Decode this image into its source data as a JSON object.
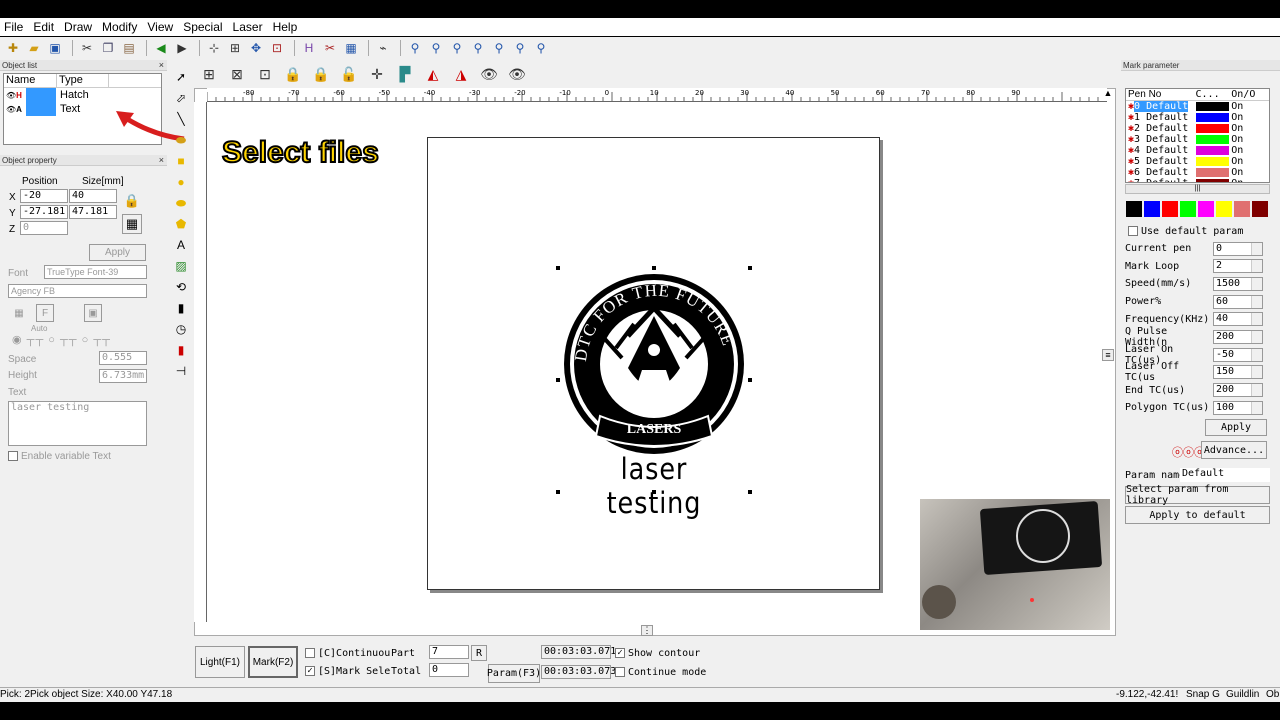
{
  "menu": [
    "File",
    "Edit",
    "Draw",
    "Modify",
    "View",
    "Special",
    "Laser",
    "Help"
  ],
  "object_list": {
    "title": "Object list",
    "col_name": "Name",
    "col_type": "Type",
    "rows": [
      {
        "type": "Hatch"
      },
      {
        "type": "Text"
      }
    ]
  },
  "object_property": {
    "title": "Object property",
    "position_label": "Position",
    "size_label": "Size[mm]",
    "x_label": "X",
    "y_label": "Y",
    "z_label": "Z",
    "x_pos": "-20",
    "y_pos": "-27.181",
    "z_pos": "0",
    "x_size": "40",
    "y_size": "47.181",
    "apply": "Apply",
    "font_label": "Font",
    "font_type": "TrueType Font-39",
    "font_name": "Agency FB",
    "auto": "Auto",
    "space_label": "Space",
    "space_value": "0.555",
    "height_label": "Height",
    "height_value": "6.733mm",
    "text_label": "Text",
    "text_value": "laser testing",
    "variable_text": "Enable variable Text"
  },
  "caption": "Select files",
  "canvas": {
    "logo_top": "DTC FOR THE FUTURE",
    "logo_bottom": "LASERS",
    "text": "laser testing",
    "ruler_labels": [
      "-80",
      "-70",
      "-60",
      "-50",
      "-40",
      "-30",
      "-20",
      "-10",
      "0",
      "10",
      "20",
      "30",
      "40",
      "50",
      "60",
      "70",
      "80",
      "90"
    ]
  },
  "bottom": {
    "light": "Light(F1)",
    "mark": "Mark(F2)",
    "continuous": "[C]Continuou",
    "mark_sele": "[S]Mark Sele",
    "part_label": "Part",
    "part_value": "7",
    "r": "R",
    "total_label": "Total",
    "total_value": "0",
    "time1": "00:03:03.071",
    "time2": "00:03:03.073",
    "param": "Param(F3)",
    "show_contour": "Show contour",
    "continue_mode": "Continue mode"
  },
  "status": {
    "left": "Pick: 2Pick object Size: X40.00 Y47.18",
    "coords": "-9.122,-42.41!",
    "snap": "Snap G",
    "guide": "Guildlin",
    "ob": "Ob"
  },
  "mark_parameter": {
    "title": "Mark parameter",
    "col_pen": "Pen No",
    "col_color": "C...",
    "col_on": "On/O",
    "pens": [
      {
        "name": "0 Default",
        "color": "#000000",
        "on": "On"
      },
      {
        "name": "1 Default",
        "color": "#0000ff",
        "on": "On"
      },
      {
        "name": "2 Default",
        "color": "#ff0000",
        "on": "On"
      },
      {
        "name": "3 Default",
        "color": "#00ff00",
        "on": "On"
      },
      {
        "name": "4 Default",
        "color": "#dd00dd",
        "on": "On"
      },
      {
        "name": "5 Default",
        "color": "#ffff00",
        "on": "On"
      },
      {
        "name": "6 Default",
        "color": "#e07070",
        "on": "On"
      },
      {
        "name": "7 Default",
        "color": "#800000",
        "on": "On"
      }
    ],
    "swatches": [
      "#000000",
      "#0000ff",
      "#ff0000",
      "#00ff00",
      "#ff00ff",
      "#ffff00",
      "#e07070",
      "#800000"
    ],
    "use_default": "Use default param",
    "params": [
      {
        "label": "Current pen",
        "value": "0"
      },
      {
        "label": "Mark Loop",
        "value": "2"
      },
      {
        "label": "Speed(mm/s)",
        "value": "1500"
      },
      {
        "label": "Power%",
        "value": "60"
      },
      {
        "label": "Frequency(KHz)",
        "value": "40"
      },
      {
        "label": "Q Pulse Width(n",
        "value": "200"
      },
      {
        "label": "Laser On TC(us)",
        "value": "-50"
      },
      {
        "label": "Laser Off TC(us",
        "value": "150"
      },
      {
        "label": "End TC(us)",
        "value": "200"
      },
      {
        "label": "Polygon TC(us)",
        "value": "100"
      }
    ],
    "apply": "Apply",
    "advance": "Advance...",
    "param_name_label": "Param name",
    "param_name_value": "Default",
    "select_lib": "Select param from library",
    "apply_default": "Apply to default"
  }
}
